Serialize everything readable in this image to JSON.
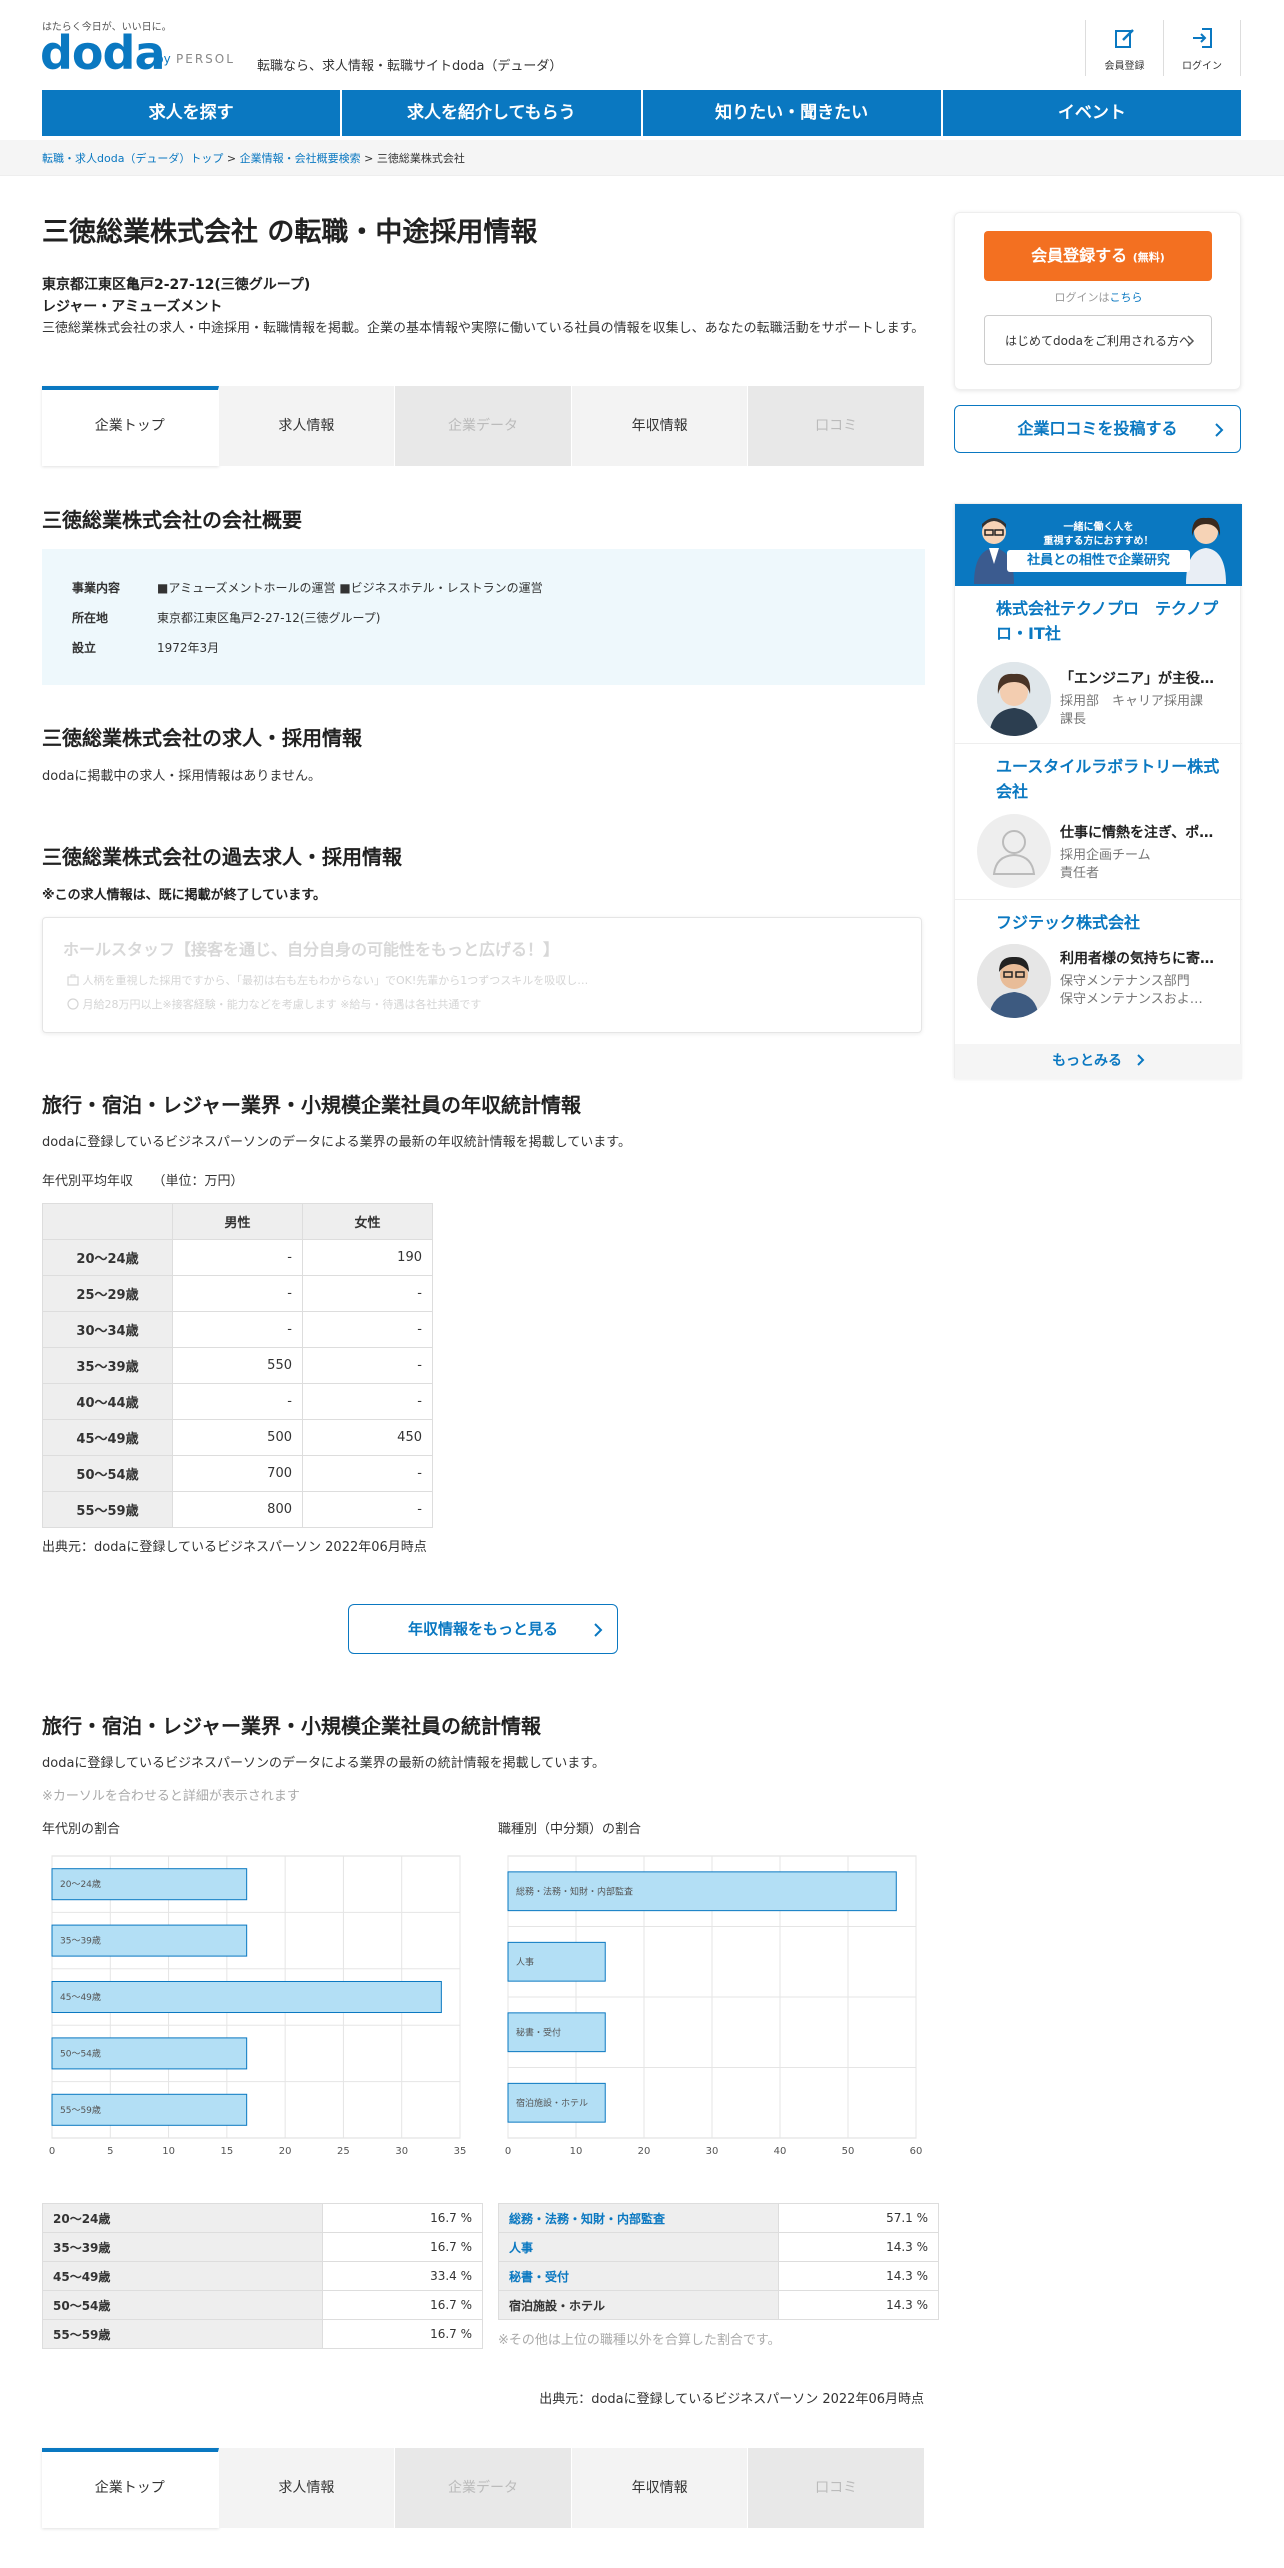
{
  "header": {
    "tagline": "はたらく今日が、いい日に。",
    "logo": "doda",
    "logo_by": "by",
    "logo_persol": "PERSOL",
    "site_desc": "転職なら、求人情報・転職サイトdoda（デューダ）",
    "register_label": "会員登録",
    "login_label": "ログイン"
  },
  "nav": [
    "求人を探す",
    "求人を紹介してもらう",
    "知りたい・聞きたい",
    "イベント"
  ],
  "breadcrumb": {
    "items": [
      "転職・求人doda（デューダ）トップ",
      "企業情報・会社概要検索"
    ],
    "current": "三徳総業株式会社",
    "sep": " > "
  },
  "company": {
    "title": "三徳総業株式会社 の転職・中途採用情報",
    "address": "東京都江東区亀戸2-27-12(三徳グループ)",
    "industry": "レジャー・アミューズメント",
    "intro": "三徳総業株式会社の求人・中途採用・転職情報を掲載。企業の基本情報や実際に働いている社員の情報を収集し、あなたの転職活動をサポートします。"
  },
  "tabs": [
    {
      "label": "企業トップ",
      "state": "active"
    },
    {
      "label": "求人情報",
      "state": "normal"
    },
    {
      "label": "企業データ",
      "state": "disabled"
    },
    {
      "label": "年収情報",
      "state": "normal"
    },
    {
      "label": "口コミ",
      "state": "disabled"
    }
  ],
  "overview": {
    "heading": "三徳総業株式会社の会社概要",
    "rows": [
      {
        "label": "事業内容",
        "value": "■アミューズメントホールの運営 ■ビジネスホテル・レストランの運営"
      },
      {
        "label": "所在地",
        "value": "東京都江東区亀戸2-27-12(三徳グループ)"
      },
      {
        "label": "設立",
        "value": "1972年3月"
      }
    ]
  },
  "jobs": {
    "heading": "三徳総業株式会社の求人・採用情報",
    "text": "dodaに掲載中の求人・採用情報はありません。"
  },
  "past": {
    "heading": "三徳総業株式会社の過去求人・採用情報",
    "note": "※この求人情報は、既に掲載が終了しています。",
    "card_title": "ホールスタッフ【接客を通じ、自分自身の可能性をもっと広げる！】",
    "line1": "人柄を重視した採用ですから、「最初は右も左もわからない」でOK!先輩から1つずつスキルを吸収し…",
    "line2": "月給28万円以上※接客経験・能力などを考慮します ※給与・待遇は各社共通です"
  },
  "salary": {
    "heading": "旅行・宿泊・レジャー業界・小規模企業社員の年収統計情報",
    "desc": "dodaに登録しているビジネスパーソンのデータによる業界の最新の年収統計情報を掲載しています。",
    "caption": "年代別平均年収　　（単位：万円）",
    "col_male": "男性",
    "col_female": "女性",
    "rows": [
      {
        "age": "20～24歳",
        "male": "-",
        "female": "190"
      },
      {
        "age": "25～29歳",
        "male": "-",
        "female": "-"
      },
      {
        "age": "30～34歳",
        "male": "-",
        "female": "-"
      },
      {
        "age": "35～39歳",
        "male": "550",
        "female": "-"
      },
      {
        "age": "40～44歳",
        "male": "-",
        "female": "-"
      },
      {
        "age": "45～49歳",
        "male": "500",
        "female": "450"
      },
      {
        "age": "50～54歳",
        "male": "700",
        "female": "-"
      },
      {
        "age": "55～59歳",
        "male": "800",
        "female": "-"
      }
    ],
    "source": "出典元：dodaに登録しているビジネスパーソン 2022年06月時点",
    "more_label": "年収情報をもっと見る"
  },
  "stats": {
    "heading": "旅行・宿泊・レジャー業界・小規模企業社員の統計情報",
    "desc": "dodaに登録しているビジネスパーソンのデータによる業界の最新の統計情報を掲載しています。",
    "hint": "※カーソルを合わせると詳細が表示されます",
    "age_title": "年代別の割合",
    "job_title": "職種別（中分類）の割合",
    "age_rows": [
      {
        "label": "20～24歳",
        "value": "16.7 %"
      },
      {
        "label": "35～39歳",
        "value": "16.7 %"
      },
      {
        "label": "45～49歳",
        "value": "33.4 %"
      },
      {
        "label": "50～54歳",
        "value": "16.7 %"
      },
      {
        "label": "55～59歳",
        "value": "16.7 %"
      }
    ],
    "job_rows": [
      {
        "label": "総務・法務・知財・内部監査",
        "value": "57.1 %"
      },
      {
        "label": "人事",
        "value": "14.3 %"
      },
      {
        "label": "秘書・受付",
        "value": "14.3 %"
      },
      {
        "label": "宿泊施設・ホテル",
        "value": "14.3 %"
      }
    ],
    "note": "※その他は上位の職種以外を合算した割合です。",
    "source": "出典元：dodaに登録しているビジネスパーソン 2022年06月時点"
  },
  "chart_data": [
    {
      "type": "bar",
      "orientation": "horizontal",
      "categories": [
        "20～24歳",
        "35～39歳",
        "45～49歳",
        "50～54歳",
        "55～59歳"
      ],
      "values": [
        16.7,
        16.7,
        33.4,
        16.7,
        16.7
      ],
      "xlim": [
        0,
        35
      ],
      "xticks": [
        0,
        5,
        10,
        15,
        20,
        25,
        30,
        35
      ],
      "grid": true,
      "color": "#b3dff5",
      "edge": "#0a78c1"
    },
    {
      "type": "bar",
      "orientation": "horizontal",
      "categories": [
        "総務・法務・知財・内部監査",
        "人事",
        "秘書・受付",
        "宿泊施設・ホテル"
      ],
      "values": [
        57.1,
        14.3,
        14.3,
        14.3
      ],
      "xlim": [
        0,
        60
      ],
      "xticks": [
        0,
        10,
        20,
        30,
        40,
        50,
        60
      ],
      "grid": true,
      "color": "#b3dff5",
      "edge": "#0a78c1"
    }
  ],
  "sidebar": {
    "register": "会員登録する",
    "register_free": "(無料)",
    "login_prefix": "ログインは",
    "login_link": "こちら",
    "first_time": "はじめてdodaをご利用される方へ",
    "review": "企業口コミを投稿する",
    "banner_t1": "一緒に働く人を",
    "banner_t2": "重視する方におすすめ！",
    "banner_pill": "社員との相性で企業研究",
    "companies": [
      {
        "name": "株式会社テクノプロ　テクノプロ・IT社",
        "line1": "「エンジニア」が主役…",
        "line2": "採用部　キャリア採用課",
        "line3": "課長"
      },
      {
        "name": "ユースタイルラボラトリー株式会社",
        "line1": "仕事に情熱を注ぎ、ポ…",
        "line2": "採用企画チーム",
        "line3": "責任者"
      },
      {
        "name": "フジテック株式会社",
        "line1": "利用者様の気持ちに寄…",
        "line2": "保守メンテナンス部門",
        "line3": "保守メンテナンスおよ…"
      }
    ],
    "more": "もっとみる"
  }
}
